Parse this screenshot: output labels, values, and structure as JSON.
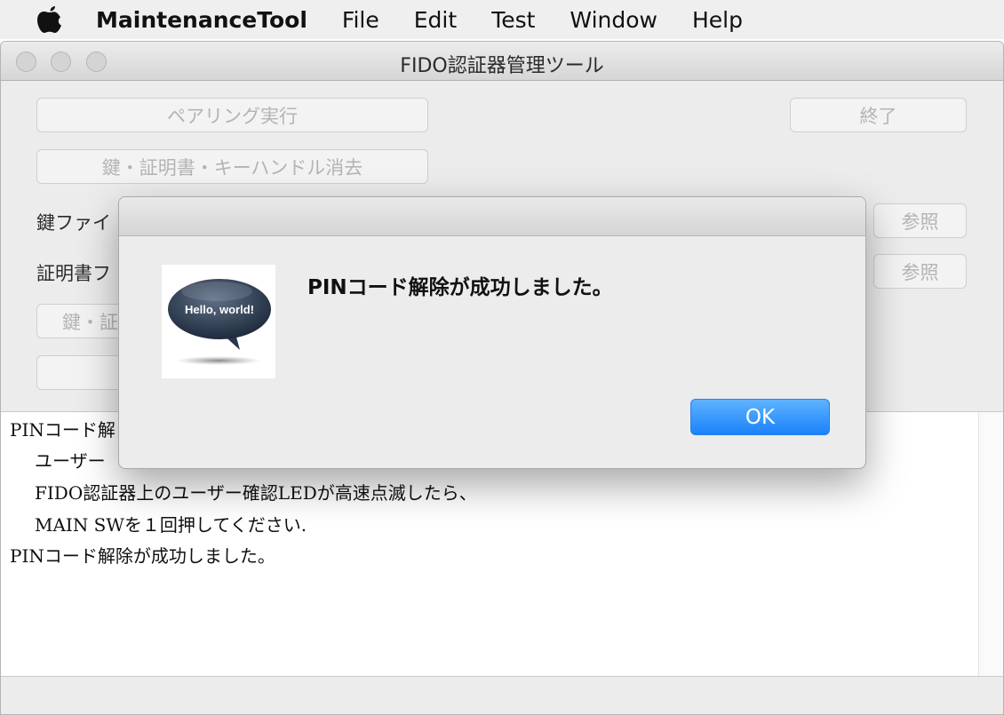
{
  "menubar": {
    "app_name": "MaintenanceTool",
    "items": [
      "File",
      "Edit",
      "Test",
      "Window",
      "Help"
    ]
  },
  "window": {
    "title": "FIDO認証器管理ツール",
    "buttons": {
      "pairing": "ペアリング実行",
      "quit": "終了",
      "erase": "鍵・証明書・キーハンドル消去",
      "browse_key": "参照",
      "browse_cert": "参照",
      "install": "鍵・証"
    },
    "labels": {
      "key_file": "鍵ファイ",
      "cert_file": "証明書フ"
    },
    "log_lines": [
      "PINコード解",
      "ユーザー",
      "FIDO認証器上のユーザー確認LEDが高速点滅したら、",
      "MAIN SWを１回押してください.",
      "PINコード解除が成功しました。"
    ]
  },
  "alert": {
    "logo_text": "Hello, world!",
    "message": "PINコード解除が成功しました。",
    "ok_label": "OK"
  },
  "colors": {
    "accent": "#1a82fb",
    "window_bg": "#ececec",
    "disabled_text": "#b4b4b4"
  }
}
